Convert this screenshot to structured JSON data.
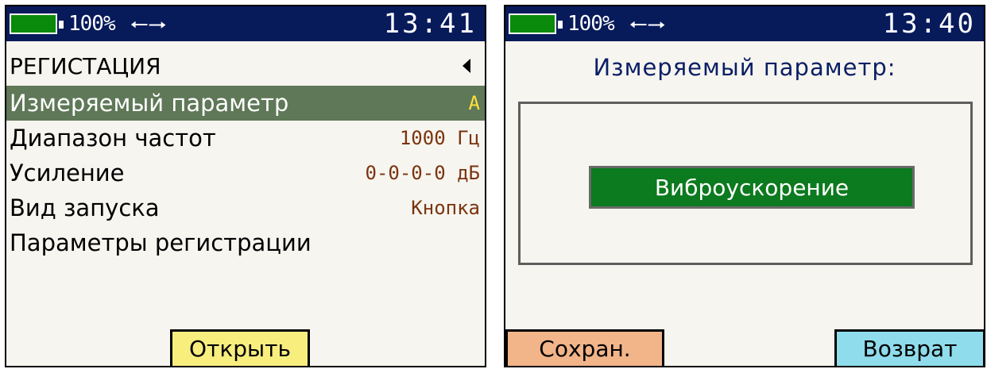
{
  "colors": {
    "status_bar_bg": "#071a5a",
    "battery_fill": "#0a8a0a",
    "selected_row_bg": "#5f7858",
    "selected_value": "#ffe23a",
    "value_text": "#7a3410",
    "heading_text": "#0a1f66",
    "option_bg": "#0c7a1e",
    "open_button": "#f8ee7e",
    "save_button": "#f2b489",
    "return_button": "#8fdcec"
  },
  "left_screen": {
    "status": {
      "battery_level": 1.0,
      "battery_text": "100%",
      "usb_icon": "usb-icon",
      "time": "13:41"
    },
    "title": "РЕГИСТАЦИЯ",
    "back_icon": "triangle-left-icon",
    "menu": [
      {
        "label": "Измеряемый параметр",
        "value": "А",
        "selected": true
      },
      {
        "label": "Диапазон частот",
        "value": "1000 Гц",
        "selected": false
      },
      {
        "label": "Усиление",
        "value": "0-0-0-0 дБ",
        "selected": false
      },
      {
        "label": "Вид запуска",
        "value": "Кнопка",
        "selected": false
      },
      {
        "label": "Параметры регистрации",
        "value": "",
        "selected": false
      }
    ],
    "open_button": "Открыть"
  },
  "right_screen": {
    "status": {
      "battery_level": 1.0,
      "battery_text": "100%",
      "usb_icon": "usb-icon",
      "time": "13:40"
    },
    "heading": "Измеряемый параметр:",
    "selected_option": "Виброускорение",
    "save_button": "Сохран.",
    "return_button": "Возврат"
  }
}
